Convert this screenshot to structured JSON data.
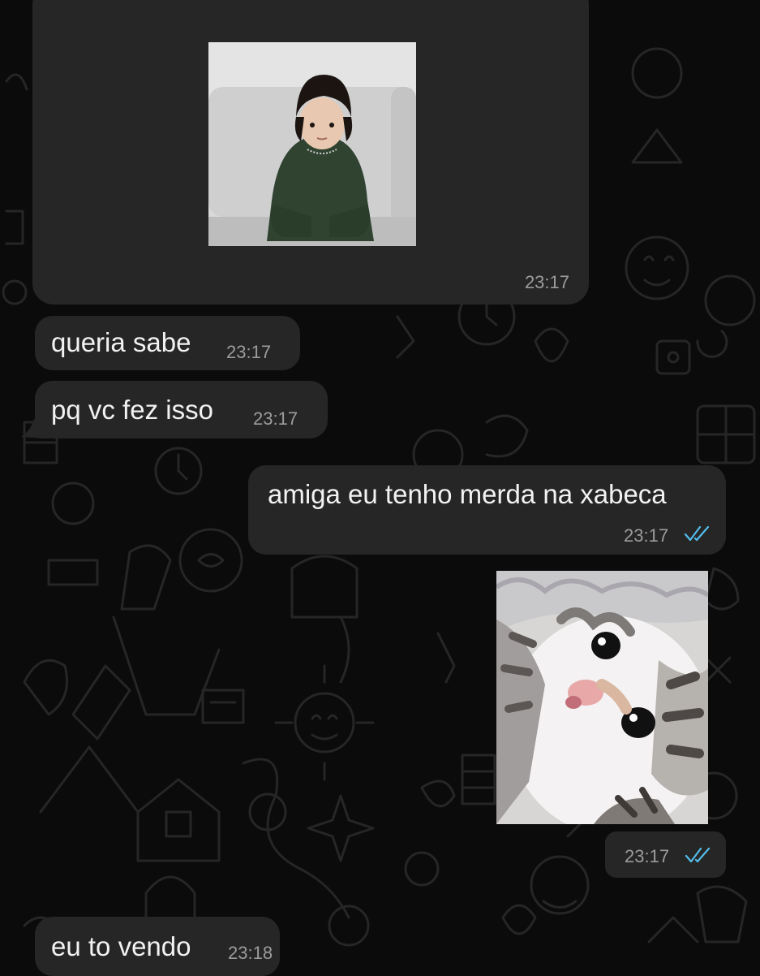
{
  "chat": {
    "messages": [
      {
        "direction": "incoming",
        "type": "image",
        "image_description": "toddler in dark green sweater sitting on a white couch",
        "time": "23:17"
      },
      {
        "direction": "incoming",
        "type": "text",
        "text": "queria sabe",
        "time": "23:17"
      },
      {
        "direction": "incoming",
        "type": "text",
        "text": "pq vc fez isso",
        "time": "23:17"
      },
      {
        "direction": "outgoing",
        "type": "text",
        "text": "amiga eu tenho merda na xabeca",
        "time": "23:17",
        "status": "read"
      },
      {
        "direction": "outgoing",
        "type": "image",
        "image_description": "close-up of a fluffy white and tabby kitten looking up",
        "time": "23:17",
        "status": "read"
      },
      {
        "direction": "incoming",
        "type": "text",
        "text": "eu to vendo",
        "time": "23:18"
      }
    ]
  },
  "colors": {
    "background": "#0b0b0b",
    "bubble": "#262626",
    "read_ticks": "#53bdeb",
    "timestamp": "#9c9c9c",
    "text": "#f2f2f2"
  },
  "icons": {
    "read_receipt": "double-check-icon"
  }
}
